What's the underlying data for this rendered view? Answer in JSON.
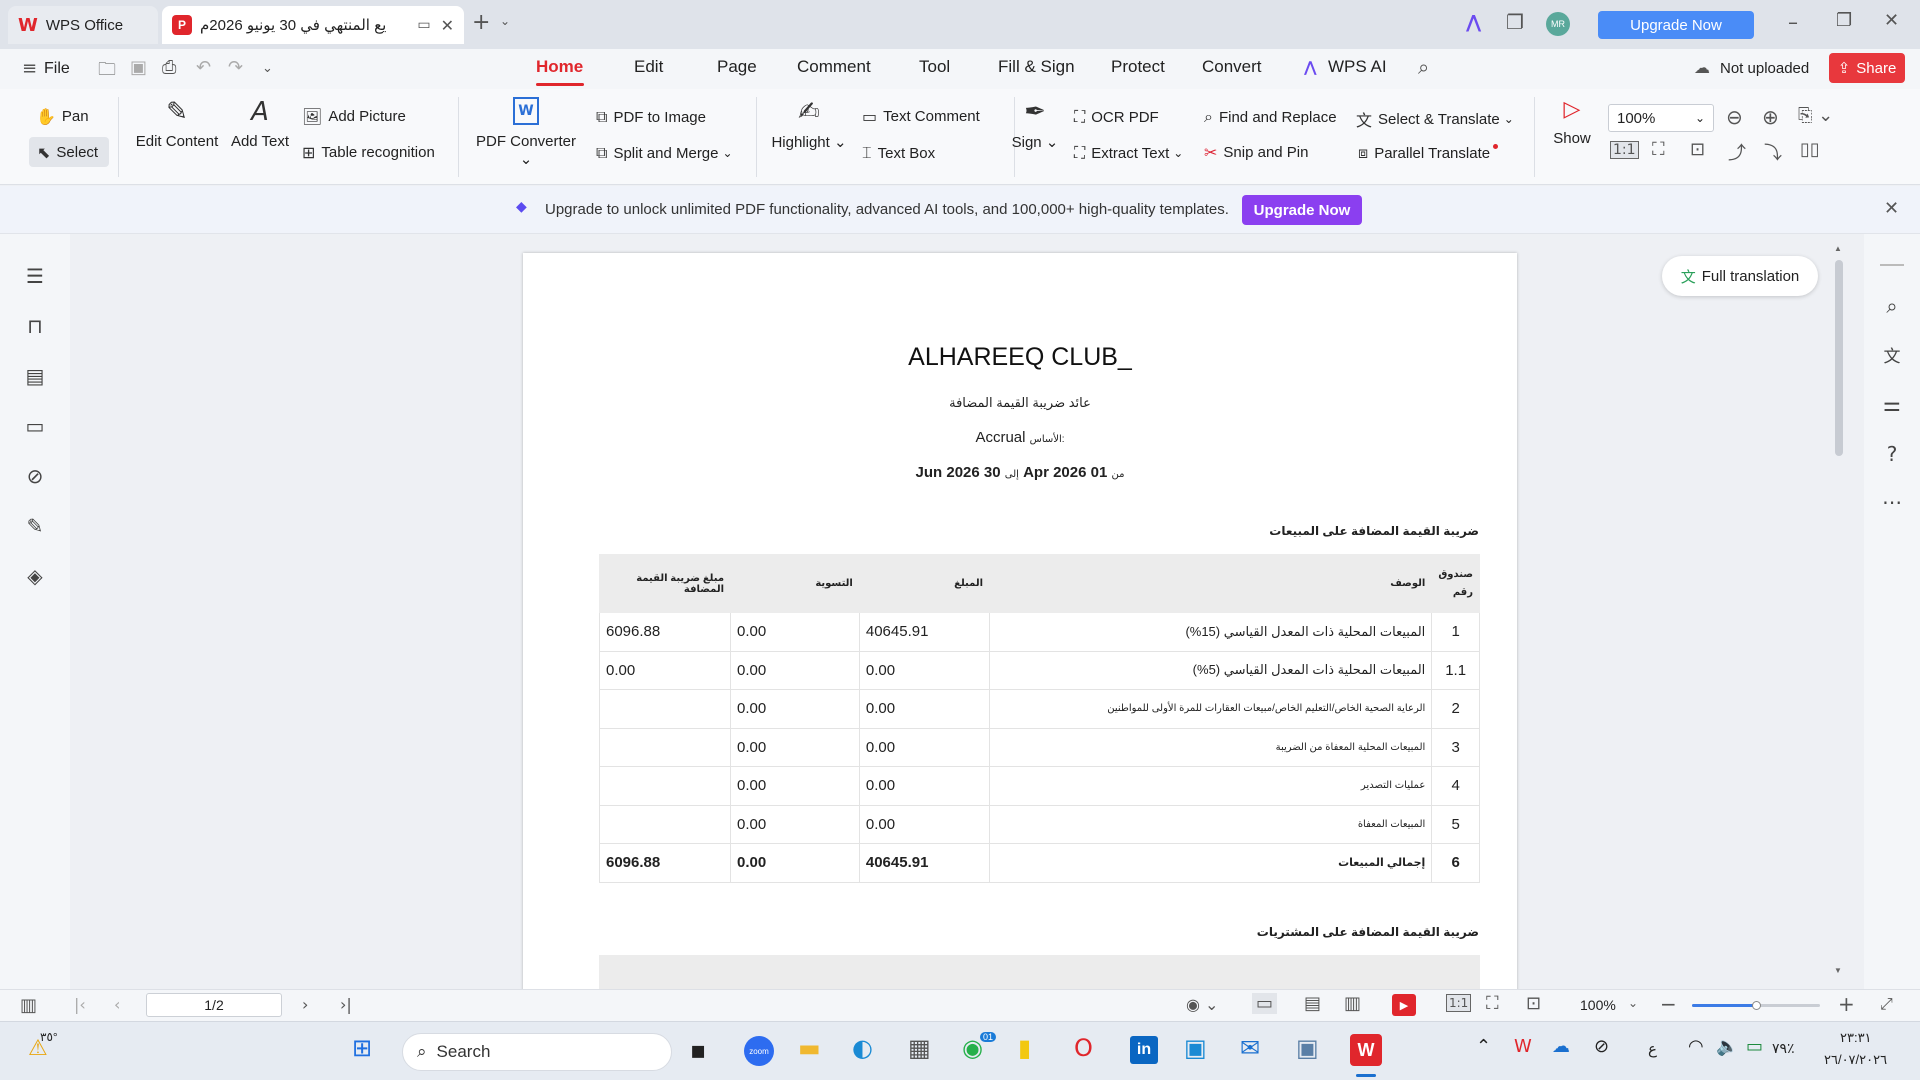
{
  "titlebar": {
    "app_tab": "WPS Office",
    "doc_tab": "يع المنتهي في 30 يونيو 2026م",
    "upgrade_label": "Upgrade Now",
    "avatar": "MR"
  },
  "menubar": {
    "file": "File",
    "tabs": [
      "Home",
      "Edit",
      "Page",
      "Comment",
      "Tool",
      "Fill & Sign",
      "Protect",
      "Convert",
      "WPS AI"
    ],
    "not_uploaded": "Not uploaded",
    "share": "Share"
  },
  "ribbon": {
    "pan": "Pan",
    "select": "Select",
    "edit_content": "Edit Content",
    "add_text": "Add Text",
    "add_picture": "Add Picture",
    "table_recognition": "Table recognition",
    "pdf_converter": "PDF Converter",
    "pdf_to_image": "PDF to Image",
    "split_merge": "Split and Merge",
    "highlight": "Highlight",
    "text_comment": "Text Comment",
    "text_box": "Text Box",
    "sign": "Sign",
    "ocr_pdf": "OCR PDF",
    "extract_text": "Extract Text",
    "find_replace": "Find and Replace",
    "snip_pin": "Snip and Pin",
    "select_translate": "Select & Translate",
    "parallel_translate": "Parallel Translate",
    "show": "Show",
    "zoom": "100%"
  },
  "banner": {
    "text": "Upgrade to unlock unlimited PDF functionality, advanced AI tools, and 100,000+ high-quality templates.",
    "button": "Upgrade Now"
  },
  "full_translation": "Full translation",
  "document": {
    "company": "ALHAREEQ CLUB_",
    "report_title": "عائد ضريبة القيمة المضافة",
    "basis_label": "الأساس:",
    "basis_value": "Accrual",
    "period_from": "من",
    "period_start": "Apr 2026 01",
    "period_to": "إلى",
    "period_end": "Jun 2026 30",
    "sales_section": "ضريبة القيمة المضافة على المبيعات",
    "purchases_section": "ضريبة القيمة المضافة على المشتريات",
    "headers": {
      "box": "صندوق رقم",
      "description": "الوصف",
      "amount": "المبلغ",
      "adjustment": "التسوية",
      "vat": "مبلغ ضريبة القيمة المضافة"
    },
    "rows": [
      {
        "box": "1",
        "description": "المبيعات المحلية ذات المعدل القياسي (15%)",
        "amount": "40645.91",
        "adjustment": "0.00",
        "vat": "6096.88"
      },
      {
        "box": "1.1",
        "description": "المبيعات المحلية ذات المعدل القياسي (5%)",
        "amount": "0.00",
        "adjustment": "0.00",
        "vat": "0.00"
      },
      {
        "box": "2",
        "description": "الرعاية الصحية الخاص/التعليم الخاص/مبيعات العقارات للمرة الأولى للمواطنين",
        "amount": "0.00",
        "adjustment": "0.00",
        "vat": ""
      },
      {
        "box": "3",
        "description": "المبيعات المحلية المعفاة من الضريبة",
        "amount": "0.00",
        "adjustment": "0.00",
        "vat": ""
      },
      {
        "box": "4",
        "description": "عمليات التصدير",
        "amount": "0.00",
        "adjustment": "0.00",
        "vat": ""
      },
      {
        "box": "5",
        "description": "المبيعات المعفاة",
        "amount": "0.00",
        "adjustment": "0.00",
        "vat": ""
      },
      {
        "box": "6",
        "description": "إجمالي المبيعات",
        "amount": "40645.91",
        "adjustment": "0.00",
        "vat": "6096.88"
      }
    ]
  },
  "statusbar": {
    "page": "1/2",
    "zoom": "100%",
    "zoom_fraction": 0.5
  },
  "taskbar": {
    "search": "Search",
    "weather": "٣٥°",
    "lang": "ع",
    "battery": "٧٩٪",
    "time": "٢٣:٣١",
    "date": "٢٦/٠٧/٢٠٢٦",
    "badge": "01"
  },
  "colors": {
    "accent_red": "#e0262c",
    "upgrade_blue": "#4a8cf7",
    "purple": "#8b3ff0"
  }
}
